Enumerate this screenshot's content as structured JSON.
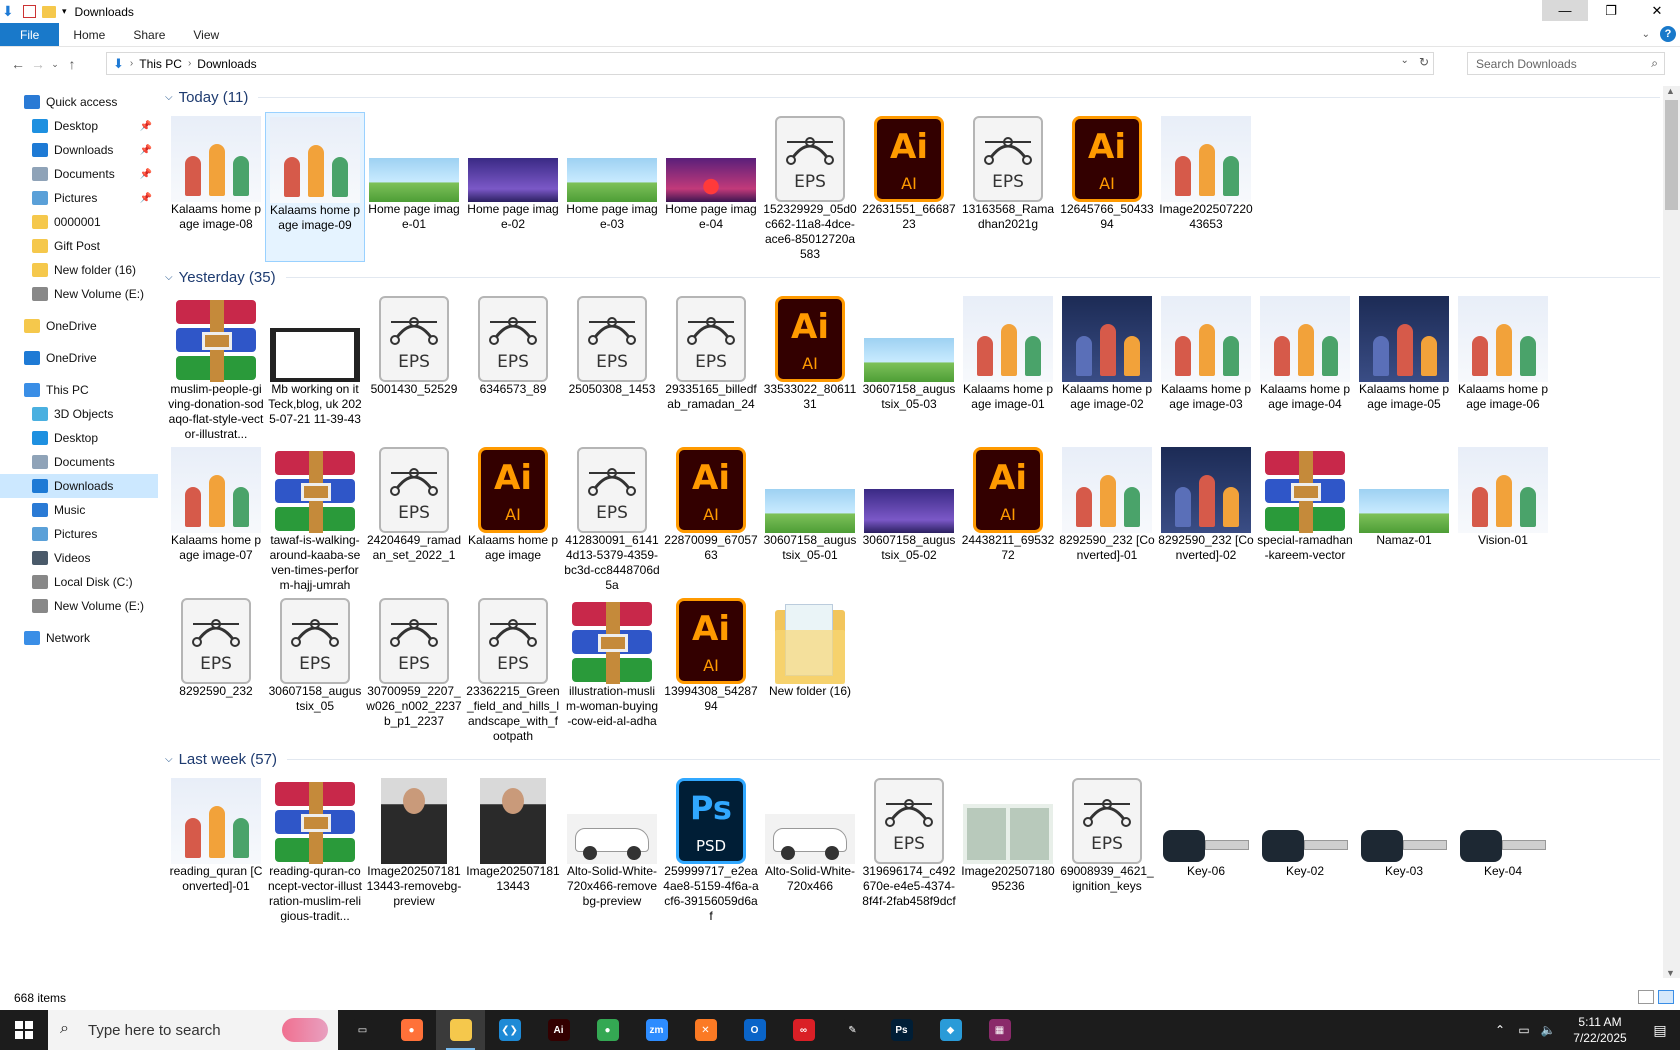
{
  "window": {
    "title": "Downloads"
  },
  "ribbon": {
    "tabs": [
      "File",
      "Home",
      "Share",
      "View"
    ]
  },
  "address": {
    "crumbs": [
      "This PC",
      "Downloads"
    ],
    "search_placeholder": "Search Downloads"
  },
  "sidebar": {
    "items": [
      {
        "label": "Quick access",
        "icon": "star-icon",
        "color": "#2a7ad5",
        "indent": 1,
        "pin": false
      },
      {
        "label": "Desktop",
        "icon": "desktop-icon",
        "color": "#1e90e0",
        "indent": 2,
        "pin": true
      },
      {
        "label": "Downloads",
        "icon": "download-icon",
        "color": "#1e7ad5",
        "indent": 2,
        "pin": true
      },
      {
        "label": "Documents",
        "icon": "documents-icon",
        "color": "#8fa3b8",
        "indent": 2,
        "pin": true
      },
      {
        "label": "Pictures",
        "icon": "pictures-icon",
        "color": "#5aa0d8",
        "indent": 2,
        "pin": true
      },
      {
        "label": "0000001",
        "icon": "folder-icon",
        "color": "#f5c84c",
        "indent": 2,
        "pin": false
      },
      {
        "label": "Gift Post",
        "icon": "folder-icon",
        "color": "#f5c84c",
        "indent": 2,
        "pin": false
      },
      {
        "label": "New folder (16)",
        "icon": "folder-icon",
        "color": "#f5c84c",
        "indent": 2,
        "pin": false
      },
      {
        "label": "New Volume (E:)",
        "icon": "drive-icon",
        "color": "#888888",
        "indent": 2,
        "pin": false
      },
      {
        "label": "OneDrive",
        "icon": "folder-icon",
        "color": "#f5c84c",
        "indent": 1,
        "pin": false
      },
      {
        "label": "OneDrive",
        "icon": "cloud-icon",
        "color": "#1e7ad5",
        "indent": 1,
        "pin": false
      },
      {
        "label": "This PC",
        "icon": "pc-icon",
        "color": "#3a8ee6",
        "indent": 1,
        "pin": false
      },
      {
        "label": "3D Objects",
        "icon": "cube-icon",
        "color": "#4ab0e0",
        "indent": 2,
        "pin": false
      },
      {
        "label": "Desktop",
        "icon": "desktop-icon",
        "color": "#1e90e0",
        "indent": 2,
        "pin": false
      },
      {
        "label": "Documents",
        "icon": "documents-icon",
        "color": "#8fa3b8",
        "indent": 2,
        "pin": false
      },
      {
        "label": "Downloads",
        "icon": "download-icon",
        "color": "#1e7ad5",
        "indent": 2,
        "pin": false,
        "selected": true
      },
      {
        "label": "Music",
        "icon": "music-icon",
        "color": "#2a7ad5",
        "indent": 2,
        "pin": false
      },
      {
        "label": "Pictures",
        "icon": "pictures-icon",
        "color": "#5aa0d8",
        "indent": 2,
        "pin": false
      },
      {
        "label": "Videos",
        "icon": "videos-icon",
        "color": "#4a5a6a",
        "indent": 2,
        "pin": false
      },
      {
        "label": "Local Disk (C:)",
        "icon": "drive-icon",
        "color": "#888888",
        "indent": 2,
        "pin": false
      },
      {
        "label": "New Volume (E:)",
        "icon": "drive-icon",
        "color": "#888888",
        "indent": 2,
        "pin": false
      },
      {
        "label": "Network",
        "icon": "network-icon",
        "color": "#3a8ee6",
        "indent": 1,
        "pin": false
      }
    ]
  },
  "groups": [
    {
      "title": "Today (11)",
      "files": [
        {
          "label": "Kalaams home page image-08",
          "type": "people"
        },
        {
          "label": "Kalaams home page image-09",
          "type": "people",
          "selected": true
        },
        {
          "label": "Home page image-01",
          "type": "landscape"
        },
        {
          "label": "Home page image-02",
          "type": "night"
        },
        {
          "label": "Home page image-03",
          "type": "landscape"
        },
        {
          "label": "Home page image-04",
          "type": "sunset"
        },
        {
          "label": "152329929_05d0c662-11a8-4dce-ace6-85012720a583",
          "type": "eps"
        },
        {
          "label": "22631551_6668723",
          "type": "ai"
        },
        {
          "label": "13163568_Ramadhan2021g",
          "type": "eps"
        },
        {
          "label": "12645766_5043394",
          "type": "ai"
        },
        {
          "label": "Image20250722043653",
          "type": "people"
        }
      ]
    },
    {
      "title": "Yesterday (35)",
      "files": [
        {
          "label": "muslim-people-giving-donation-sodaqo-flat-style-vector-illustrat...",
          "type": "rar"
        },
        {
          "label": "Mb working on it Teck,blog, uk 2025-07-21 11-39-43",
          "type": "video"
        },
        {
          "label": "5001430_52529",
          "type": "eps"
        },
        {
          "label": "6346573_89",
          "type": "eps"
        },
        {
          "label": "25050308_1453",
          "type": "eps"
        },
        {
          "label": "29335165_billedfab_ramadan_24",
          "type": "eps"
        },
        {
          "label": "33533022_8061131",
          "type": "ai"
        },
        {
          "label": "30607158_augustsix_05-03",
          "type": "landscape"
        },
        {
          "label": "Kalaams home page image-01",
          "type": "people"
        },
        {
          "label": "Kalaams home page image-02",
          "type": "peopledark"
        },
        {
          "label": "Kalaams home page image-03",
          "type": "people"
        },
        {
          "label": "Kalaams home page image-04",
          "type": "people"
        },
        {
          "label": "Kalaams home page image-05",
          "type": "peopledark"
        },
        {
          "label": "Kalaams home page image-06",
          "type": "people"
        },
        {
          "label": "Kalaams home page image-07",
          "type": "people"
        },
        {
          "label": "tawaf-is-walking-around-kaaba-seven-times-perform-hajj-umrah",
          "type": "rar"
        },
        {
          "label": "24204649_ramadan_set_2022_1",
          "type": "eps"
        },
        {
          "label": "Kalaams home page image",
          "type": "ai"
        },
        {
          "label": "412830091_61414d13-5379-4359-bc3d-cc8448706d5a",
          "type": "eps"
        },
        {
          "label": "22870099_6705763",
          "type": "ai"
        },
        {
          "label": "30607158_augustsix_05-01",
          "type": "landscape"
        },
        {
          "label": "30607158_augustsix_05-02",
          "type": "night"
        },
        {
          "label": "24438211_6953272",
          "type": "ai"
        },
        {
          "label": "8292590_232 [Converted]-01",
          "type": "people"
        },
        {
          "label": "8292590_232 [Converted]-02",
          "type": "peopledark"
        },
        {
          "label": "special-ramadhan-kareem-vector",
          "type": "rar"
        },
        {
          "label": "Namaz-01",
          "type": "landscape"
        },
        {
          "label": "Vision-01",
          "type": "people"
        },
        {
          "label": "8292590_232",
          "type": "eps"
        },
        {
          "label": "30607158_augustsix_05",
          "type": "eps"
        },
        {
          "label": "30700959_2207_w026_n002_2237b_p1_2237",
          "type": "eps"
        },
        {
          "label": "23362215_Green_field_and_hills_landscape_with_footpath",
          "type": "eps"
        },
        {
          "label": "illustration-muslim-woman-buying-cow-eid-al-adha",
          "type": "rar"
        },
        {
          "label": "13994308_5428794",
          "type": "ai"
        },
        {
          "label": "New folder (16)",
          "type": "folder"
        }
      ]
    },
    {
      "title": "Last week (57)",
      "files": [
        {
          "label": "reading_quran [Converted]-01",
          "type": "people"
        },
        {
          "label": "reading-quran-concept-vector-illustration-muslim-religious-tradit...",
          "type": "rar"
        },
        {
          "label": "Image20250718113443-removebg-preview",
          "type": "photo"
        },
        {
          "label": "Image20250718113443",
          "type": "photo"
        },
        {
          "label": "Alto-Solid-White-720x466-removebg-preview",
          "type": "car"
        },
        {
          "label": "259999717_e2ea4ae8-5159-4f6a-acf6-39156059d6af",
          "type": "psd"
        },
        {
          "label": "Alto-Solid-White-720x466",
          "type": "car"
        },
        {
          "label": "319696174_c492670e-e4e5-4374-8f4f-2fab458f9dcf",
          "type": "eps"
        },
        {
          "label": "Image20250718095236",
          "type": "pair"
        },
        {
          "label": "69008939_4621_ignition_keys",
          "type": "eps"
        },
        {
          "label": "Key-06",
          "type": "key"
        },
        {
          "label": "Key-02",
          "type": "key"
        },
        {
          "label": "Key-03",
          "type": "key"
        },
        {
          "label": "Key-04",
          "type": "key"
        }
      ]
    }
  ],
  "icon_text": {
    "eps": "EPS",
    "ai_big": "Ai",
    "ai_small": "AI",
    "ps_big": "Ps",
    "ps_small": "PSD"
  },
  "status": {
    "items": "668 items"
  },
  "taskbar": {
    "search_placeholder": "Type here to search",
    "apps": [
      {
        "name": "task-view-icon",
        "color": "#1c1c1c",
        "glyph": "▭"
      },
      {
        "name": "firefox-icon",
        "color": "#ff7139",
        "glyph": "●"
      },
      {
        "name": "file-explorer-icon",
        "color": "#f5c84c",
        "glyph": "",
        "active": true
      },
      {
        "name": "vscode-icon",
        "color": "#1e8ad6",
        "glyph": "❮❯"
      },
      {
        "name": "illustrator-icon",
        "color": "#330000",
        "glyph": "Ai"
      },
      {
        "name": "chrome-icon",
        "color": "#34a853",
        "glyph": "●"
      },
      {
        "name": "zoom-icon",
        "color": "#2d8cff",
        "glyph": "zm"
      },
      {
        "name": "xampp-icon",
        "color": "#fb7a24",
        "glyph": "✕"
      },
      {
        "name": "outlook-icon",
        "color": "#0a64c8",
        "glyph": "O"
      },
      {
        "name": "creative-cloud-icon",
        "color": "#da1f26",
        "glyph": "∞"
      },
      {
        "name": "pen-tool-icon",
        "color": "#1c1c1c",
        "glyph": "✎"
      },
      {
        "name": "photoshop-icon",
        "color": "#001e36",
        "glyph": "Ps"
      },
      {
        "name": "app-diamond-icon",
        "color": "#2a9bd8",
        "glyph": "◆"
      },
      {
        "name": "winrar-icon",
        "color": "#8a2a6a",
        "glyph": "▦"
      }
    ],
    "time": "5:11 AM",
    "date": "7/22/2025"
  }
}
